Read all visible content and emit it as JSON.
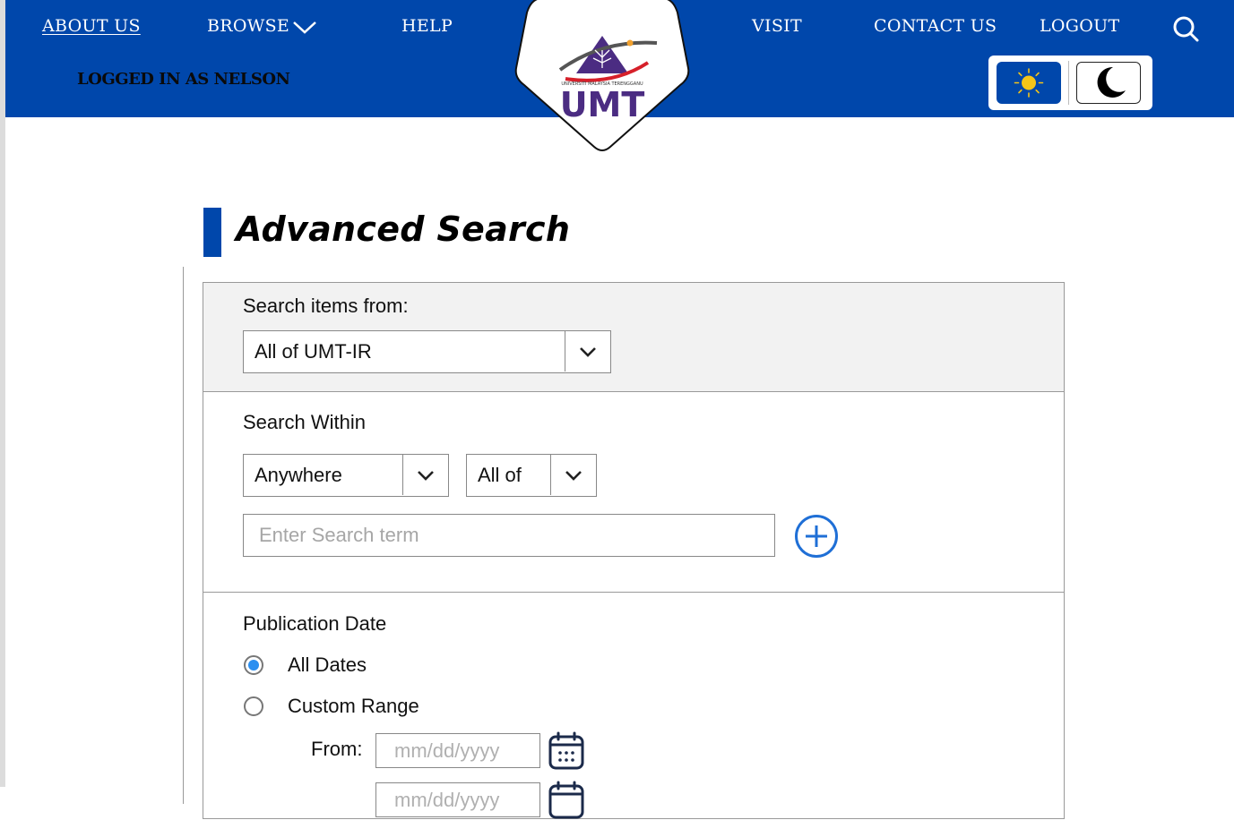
{
  "nav": {
    "about": "ABOUT US",
    "browse": "BROWSE",
    "help": "HELP",
    "visit": "VISIT",
    "contact": "CONTACT US",
    "logout": "LOGOUT",
    "search_icon": "search-icon"
  },
  "user": {
    "logged_in_text": "LOGGED IN AS NELSON"
  },
  "logo": {
    "line1": "UNIVERSITI MALAYSIA TERENGGANU",
    "line2": "UMT"
  },
  "theme": {
    "light_icon": "sun-icon",
    "dark_icon": "moon-icon"
  },
  "page": {
    "title": "Advanced Search"
  },
  "search_from": {
    "label": "Search items from:",
    "selected": "All of UMT-IR"
  },
  "search_within": {
    "label": "Search Within",
    "field_selected": "Anywhere",
    "match_selected": "All of",
    "term_placeholder": "Enter Search term",
    "add_icon": "plus-circle-icon"
  },
  "publication_date": {
    "label": "Publication Date",
    "options": [
      {
        "label": "All Dates",
        "checked": true
      },
      {
        "label": "Custom Range",
        "checked": false
      }
    ],
    "from_label": "From:",
    "from_placeholder": "mm/dd/yyyy",
    "to_placeholder": "mm/dd/yyyy",
    "calendar_icon": "calendar-icon"
  },
  "colors": {
    "primary": "#0047ab",
    "radio_accent": "#2b8ff0",
    "add_button": "#1f6fd6"
  }
}
